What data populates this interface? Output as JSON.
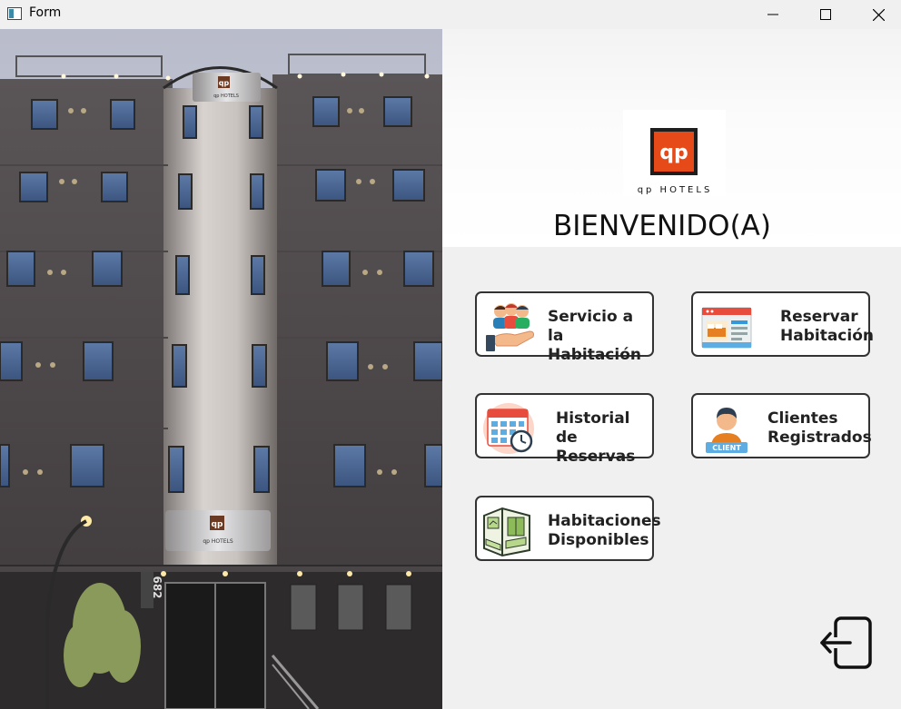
{
  "window": {
    "title": "Form"
  },
  "logo": {
    "mark": "qp",
    "text": "qp HOTELS"
  },
  "welcome": "BIENVENIDO(A)",
  "buttons": {
    "room_service": "Servicio a la\nHabitación",
    "reserve_room": "Reservar\nHabitación",
    "reservation_history": "Historial de\nReservas",
    "registered_clients": "Clientes\nRegistrados",
    "available_rooms": "Habitaciones\nDisponibles"
  },
  "building": {
    "sign_mark": "qp",
    "sign_text": "qp HOTELS",
    "street_number": "682"
  },
  "icons": {
    "client_badge": "CLIENT",
    "names": [
      "room-service-icon",
      "reserve-room-icon",
      "reservation-history-icon",
      "client-icon",
      "available-rooms-icon",
      "exit-icon"
    ]
  },
  "colors": {
    "logo_orange": "#e64a19",
    "button_border": "#333333",
    "panel_bg": "#f0f0f0"
  }
}
